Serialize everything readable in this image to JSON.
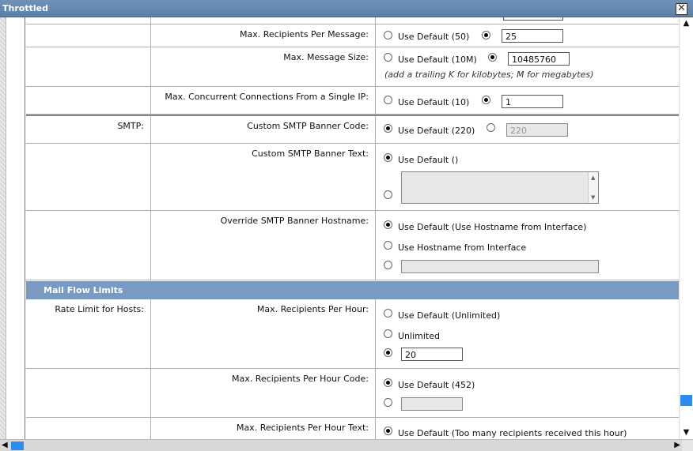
{
  "window": {
    "title": "Throttled",
    "close_glyph": "✕"
  },
  "rows": {
    "max_recipients_per_message": {
      "label": "Max. Recipients Per Message:",
      "default_option": "Use Default (50)",
      "value": "25"
    },
    "max_message_size": {
      "label": "Max. Message Size:",
      "default_option": "Use Default (10M)",
      "value": "10485760",
      "note": "(add a trailing K for kilobytes; M for megabytes)"
    },
    "max_concurrent_connections": {
      "label": "Max. Concurrent Connections From a Single IP:",
      "default_option": "Use Default (10)",
      "value": "1"
    },
    "smtp_banner_code": {
      "section": "SMTP:",
      "label": "Custom SMTP Banner Code:",
      "default_option": "Use Default (220)",
      "value": "220"
    },
    "smtp_banner_text": {
      "label": "Custom SMTP Banner Text:",
      "default_option": "Use Default ()"
    },
    "smtp_banner_hostname": {
      "label": "Override SMTP Banner Hostname:",
      "default_option": "Use Default (Use Hostname from Interface)",
      "option2": "Use Hostname from Interface"
    }
  },
  "mail_flow": {
    "header": "Mail Flow Limits",
    "section": "Rate Limit for Hosts:",
    "per_hour": {
      "label": "Max. Recipients Per Hour:",
      "default_option": "Use Default (Unlimited)",
      "option2": "Unlimited",
      "value": "20"
    },
    "per_hour_code": {
      "label": "Max. Recipients Per Hour Code:",
      "default_option": "Use Default (452)"
    },
    "per_hour_text": {
      "label": "Max. Recipients Per Hour Text:",
      "default_option": "Use Default (Too many recipients received this hour)"
    }
  },
  "scrollbars": {
    "up": "▲",
    "down": "▼",
    "left": "◀",
    "right": "▶"
  }
}
